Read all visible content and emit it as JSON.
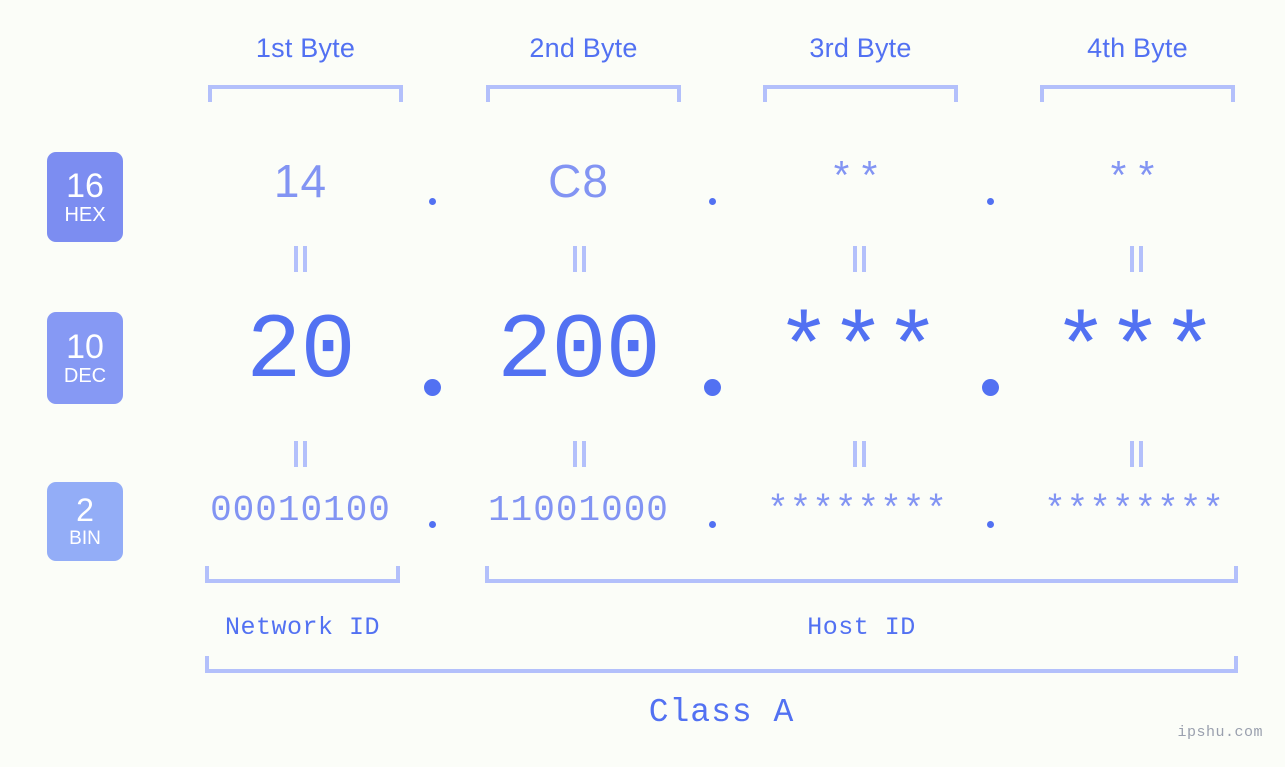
{
  "meta": {
    "background_color": "#fbfdf8",
    "accent_color": "#5271f2",
    "muted_accent_color": "#8294f3",
    "light_accent_color": "#b3c0fb",
    "watermark": "ipshu.com"
  },
  "byte_headers": [
    {
      "label": "1st Byte"
    },
    {
      "label": "2nd Byte"
    },
    {
      "label": "3rd Byte"
    },
    {
      "label": "4th Byte"
    }
  ],
  "bases": [
    {
      "number": "16",
      "name": "HEX",
      "color": "#7c8df1"
    },
    {
      "number": "10",
      "name": "DEC",
      "color": "#8699f4"
    },
    {
      "number": "2",
      "name": "BIN",
      "color": "#93adf7"
    }
  ],
  "rows": {
    "hex": {
      "base_number": "16",
      "base_name": "HEX",
      "values": [
        "14",
        "C8",
        "**",
        "**"
      ],
      "separator": "."
    },
    "dec": {
      "base_number": "10",
      "base_name": "DEC",
      "values": [
        "20",
        "200",
        "***",
        "***"
      ],
      "separator": "."
    },
    "bin": {
      "base_number": "2",
      "base_name": "BIN",
      "values": [
        "00010100",
        "11001000",
        "********",
        "********"
      ],
      "separator": "."
    }
  },
  "equals_marker": "||",
  "id_brackets": [
    {
      "label": "Network ID"
    },
    {
      "label": "Host ID"
    }
  ],
  "class_bracket": {
    "label": "Class A"
  }
}
